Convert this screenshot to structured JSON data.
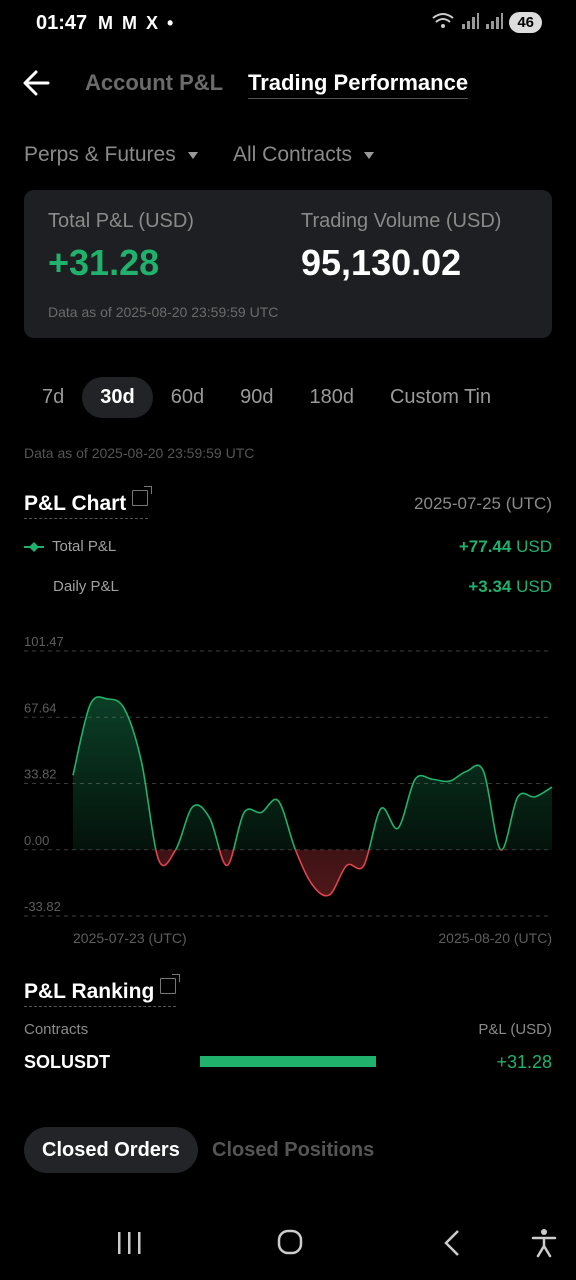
{
  "status": {
    "time": "01:47",
    "icons": "M M X •",
    "battery": "46"
  },
  "header": {
    "tab_account": "Account P&L",
    "tab_trading": "Trading Performance"
  },
  "filters": {
    "product": "Perps & Futures",
    "contracts": "All Contracts"
  },
  "summary": {
    "pnl_label": "Total P&L (USD)",
    "pnl_value": "+31.28",
    "volume_label": "Trading Volume (USD)",
    "volume_value": "95,130.02",
    "asof": "Data as of 2025-08-20 23:59:59 UTC"
  },
  "ranges": [
    "7d",
    "30d",
    "60d",
    "90d",
    "180d",
    "Custom Tin"
  ],
  "active_range": "30d",
  "asof2": "Data as of 2025-08-20 23:59:59 UTC",
  "chart_section": {
    "title": "P&L Chart",
    "hover_date": "2025-07-25 (UTC)",
    "total_label": "Total P&L",
    "total_value": "+77.44",
    "total_unit": "USD",
    "daily_label": "Daily P&L",
    "daily_value": "+3.34",
    "daily_unit": "USD"
  },
  "chart_data": {
    "type": "area",
    "y_ticks": [
      "101.47",
      "67.64",
      "33.82",
      "0.00",
      "-33.82"
    ],
    "ylim": [
      -33.82,
      101.47
    ],
    "x_start_label": "2025-07-23 (UTC)",
    "x_end_label": "2025-08-20 (UTC)",
    "grid": true,
    "series": [
      {
        "values": [
          38,
          74,
          77,
          72,
          45,
          -5,
          0,
          22,
          16,
          -8,
          19,
          19,
          25,
          0,
          -18,
          -23,
          -8,
          -8,
          21,
          11,
          36,
          36,
          35,
          40,
          40,
          0,
          27,
          27,
          32
        ]
      }
    ],
    "colors": {
      "positive": "#20b26c",
      "negative": "#e0434b"
    }
  },
  "ranking": {
    "title": "P&L Ranking",
    "col_contracts": "Contracts",
    "col_pnl": "P&L (USD)",
    "rows": [
      {
        "contract": "SOLUSDT",
        "value": "+31.28",
        "fraction": 1
      }
    ]
  },
  "bottom_tabs": {
    "closed_orders": "Closed Orders",
    "closed_positions": "Closed Positions"
  }
}
